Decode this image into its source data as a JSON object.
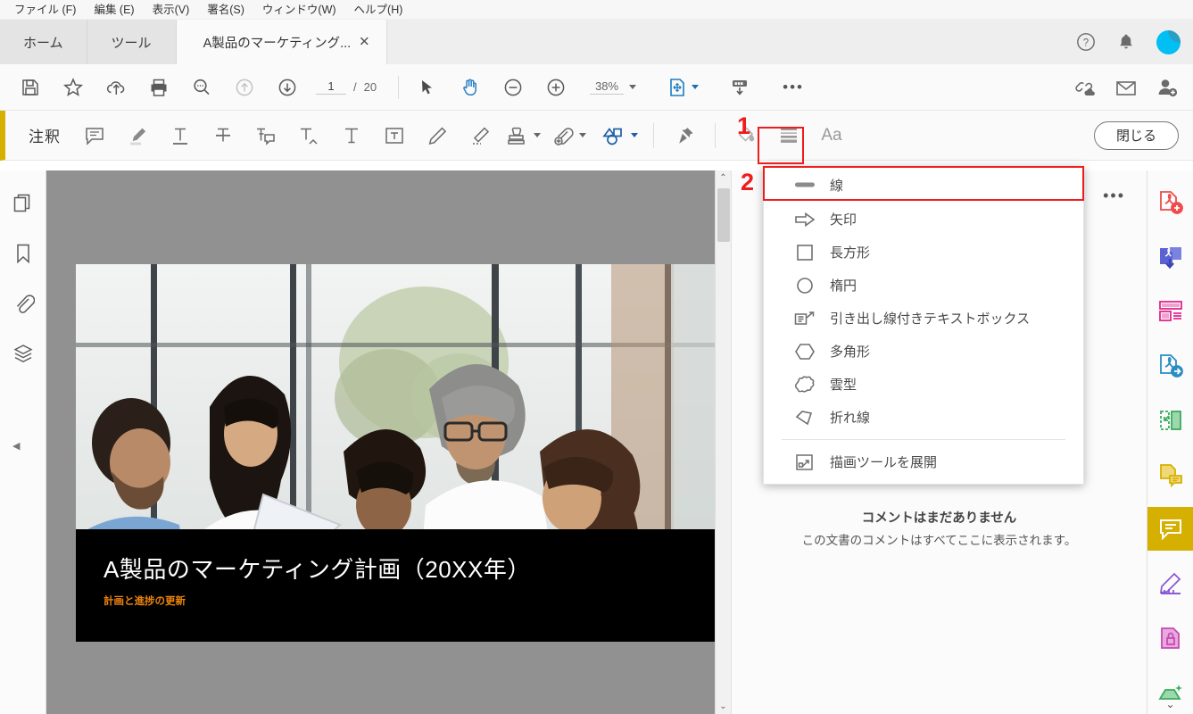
{
  "menubar": {
    "items": [
      {
        "label": "ファイル (F)"
      },
      {
        "label": "編集 (E)"
      },
      {
        "label": "表示(V)"
      },
      {
        "label": "署名(S)"
      },
      {
        "label": "ウィンドウ(W)"
      },
      {
        "label": "ヘルプ(H)"
      }
    ]
  },
  "tabs": {
    "home": "ホーム",
    "tools": "ツール",
    "document": "A製品のマーケティング...",
    "close_glyph": "✕"
  },
  "header_icons": {
    "help": "?",
    "bell": "bell-icon",
    "avatar": "user-avatar"
  },
  "toolbar": {
    "save": "save-icon",
    "favorite": "star-icon",
    "upload_cloud": "cloud-upload-icon",
    "print": "print-icon",
    "find": "search-icon",
    "prev_page": "arrow-up-circle-icon",
    "next_page": "arrow-down-circle-icon",
    "page_current": "1",
    "page_sep": "/",
    "page_total": "20",
    "select_tool": "cursor-icon",
    "hand_tool": "hand-icon",
    "zoom_out": "minus-circle-icon",
    "zoom_in": "plus-circle-icon",
    "zoom_level": "38%",
    "fit_page": "fit-page-icon",
    "scroll_mode": "scroll-mode-icon",
    "more": "•••",
    "share_link": "link-share-icon",
    "email": "envelope-icon",
    "add_user": "add-person-icon"
  },
  "annotation_bar": {
    "title": "注釈",
    "tools": [
      {
        "name": "sticky-note",
        "icon": "comment-bubble"
      },
      {
        "name": "highlight",
        "icon": "highlighter"
      },
      {
        "name": "underline",
        "icon": "text-underline"
      },
      {
        "name": "strikethrough",
        "icon": "text-strikethrough"
      },
      {
        "name": "replace-text",
        "icon": "text-replace-note"
      },
      {
        "name": "insert-text",
        "icon": "text-insert-caret"
      },
      {
        "name": "add-text",
        "icon": "text-T"
      },
      {
        "name": "text-box",
        "icon": "text-box"
      },
      {
        "name": "draw-freehand",
        "icon": "pencil"
      },
      {
        "name": "erase",
        "icon": "eraser"
      },
      {
        "name": "stamp",
        "icon": "stamp",
        "has_caret": true
      },
      {
        "name": "attach",
        "icon": "paperclip-plus",
        "has_caret": true
      },
      {
        "name": "drawing-tools",
        "icon": "shapes",
        "has_caret": true,
        "selected": true
      }
    ],
    "right_tools": [
      {
        "name": "pin",
        "icon": "pushpin"
      },
      {
        "name": "fill-color",
        "icon": "paint-bucket"
      },
      {
        "name": "line-thickness",
        "icon": "line-styles"
      },
      {
        "name": "text-properties",
        "icon": "Aa"
      }
    ],
    "close_label": "閉じる"
  },
  "shapes_menu": {
    "items": [
      {
        "label": "線",
        "icon": "line-shape",
        "highlighted": true
      },
      {
        "label": "矢印",
        "icon": "arrow-shape"
      },
      {
        "label": "長方形",
        "icon": "rectangle-shape"
      },
      {
        "label": "楕円",
        "icon": "ellipse-shape"
      },
      {
        "label": "引き出し線付きテキストボックス",
        "icon": "callout-shape"
      },
      {
        "label": "多角形",
        "icon": "polygon-shape"
      },
      {
        "label": "雲型",
        "icon": "cloud-shape"
      },
      {
        "label": "折れ線",
        "icon": "polyline-shape"
      }
    ],
    "expand_label": "描画ツールを展開",
    "expand_icon": "expand-tools-icon"
  },
  "left_rail": {
    "items": [
      {
        "name": "page-thumbnails",
        "icon": "pages-icon"
      },
      {
        "name": "bookmarks",
        "icon": "bookmark-icon"
      },
      {
        "name": "attachments",
        "icon": "paperclip-icon"
      },
      {
        "name": "layers",
        "icon": "layers-icon"
      }
    ],
    "collapse_glyph": "◀"
  },
  "document": {
    "slide_title": "A製品のマーケティング計画（20XX年）",
    "slide_subtitle": "計画と進捗の更新"
  },
  "comments_panel": {
    "more_glyph": "•••",
    "empty_title": "コメントはまだありません",
    "empty_subtitle": "この文書のコメントはすべてここに表示されます。"
  },
  "right_rail": {
    "items": [
      {
        "name": "create-pdf",
        "icon": "pdf-add-icon",
        "color": "#ef4b4b"
      },
      {
        "name": "combine-files",
        "icon": "pdf-combine-icon",
        "color": "#5b63d3"
      },
      {
        "name": "organize-pages",
        "icon": "organize-pages-icon",
        "color": "#e0268c"
      },
      {
        "name": "export-pdf",
        "icon": "pdf-export-icon",
        "color": "#2a8dc4"
      },
      {
        "name": "edit-pdf",
        "icon": "edit-pdf-icon",
        "color": "#3aab5d"
      },
      {
        "name": "fill-sign",
        "icon": "fill-sign-icon",
        "color": "#d6b000"
      },
      {
        "name": "comment",
        "icon": "comment-icon",
        "color": "#ffffff",
        "selected": true
      },
      {
        "name": "measure",
        "icon": "measure-icon",
        "color": "#8b5bd6"
      },
      {
        "name": "protect",
        "icon": "protect-icon",
        "color": "#c54bb0"
      },
      {
        "name": "optimize-pdf",
        "icon": "optimize-icon",
        "color": "#3aab5d"
      }
    ],
    "chevron_glyph": "⌄"
  },
  "callouts": {
    "one": "1",
    "two": "2"
  },
  "colors": {
    "accent_yellow": "#d6b000",
    "annotation_red": "#ee1c1c",
    "adobe_blue": "#1473b5",
    "subtitle_orange": "#e8820c"
  }
}
